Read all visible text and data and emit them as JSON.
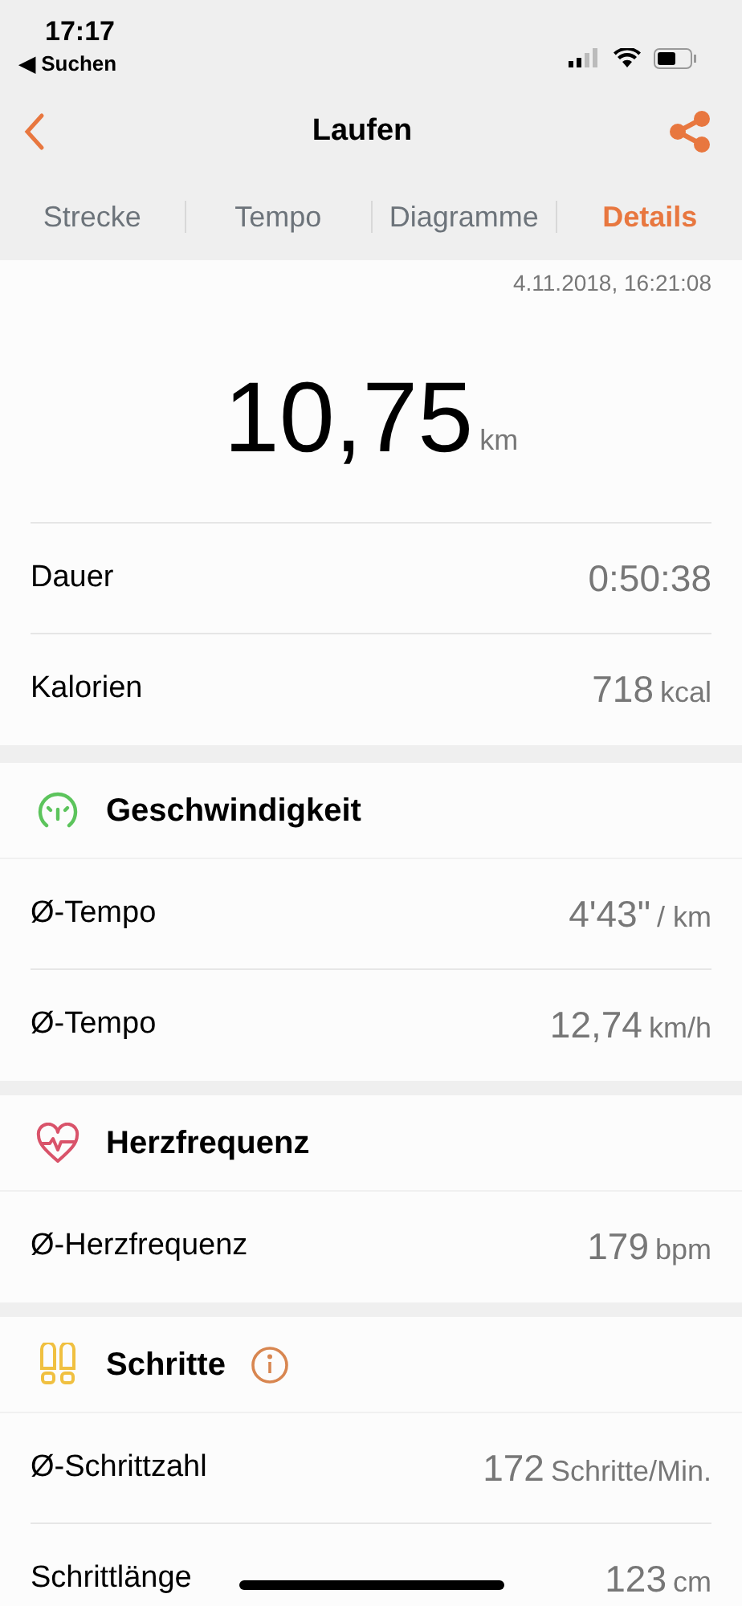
{
  "status_bar": {
    "time": "17:17",
    "back_app": "Suchen",
    "back_glyph": "◀"
  },
  "nav": {
    "title": "Laufen"
  },
  "tabs": [
    {
      "label": "Strecke",
      "selected": false
    },
    {
      "label": "Tempo",
      "selected": false
    },
    {
      "label": "Diagramme",
      "selected": false
    },
    {
      "label": "Details",
      "selected": true
    }
  ],
  "summary": {
    "date": "4.11.2018, 16:21:08",
    "distance": "10,75",
    "distance_unit": "km",
    "rows": [
      {
        "label": "Dauer",
        "value": "0:50:38"
      },
      {
        "label": "Kalorien",
        "value": "718",
        "unit": "kcal"
      }
    ]
  },
  "sections": [
    {
      "kind": "speed",
      "title": "Geschwindigkeit",
      "info": false,
      "rows": [
        {
          "label": "Ø-Tempo",
          "value": "4'43\"",
          "unit": "/ km"
        },
        {
          "label": "Ø-Tempo",
          "value": "12,74",
          "unit": "km/h"
        }
      ]
    },
    {
      "kind": "heart",
      "title": "Herzfrequenz",
      "info": false,
      "rows": [
        {
          "label": "Ø-Herzfrequenz",
          "value": "179",
          "unit": "bpm"
        }
      ]
    },
    {
      "kind": "steps",
      "title": "Schritte",
      "info": true,
      "rows": [
        {
          "label": "Ø-Schrittzahl",
          "value": "172",
          "unit": "Schritte/Min."
        },
        {
          "label": "Schrittlänge",
          "value": "123",
          "unit": "cm"
        }
      ]
    }
  ]
}
